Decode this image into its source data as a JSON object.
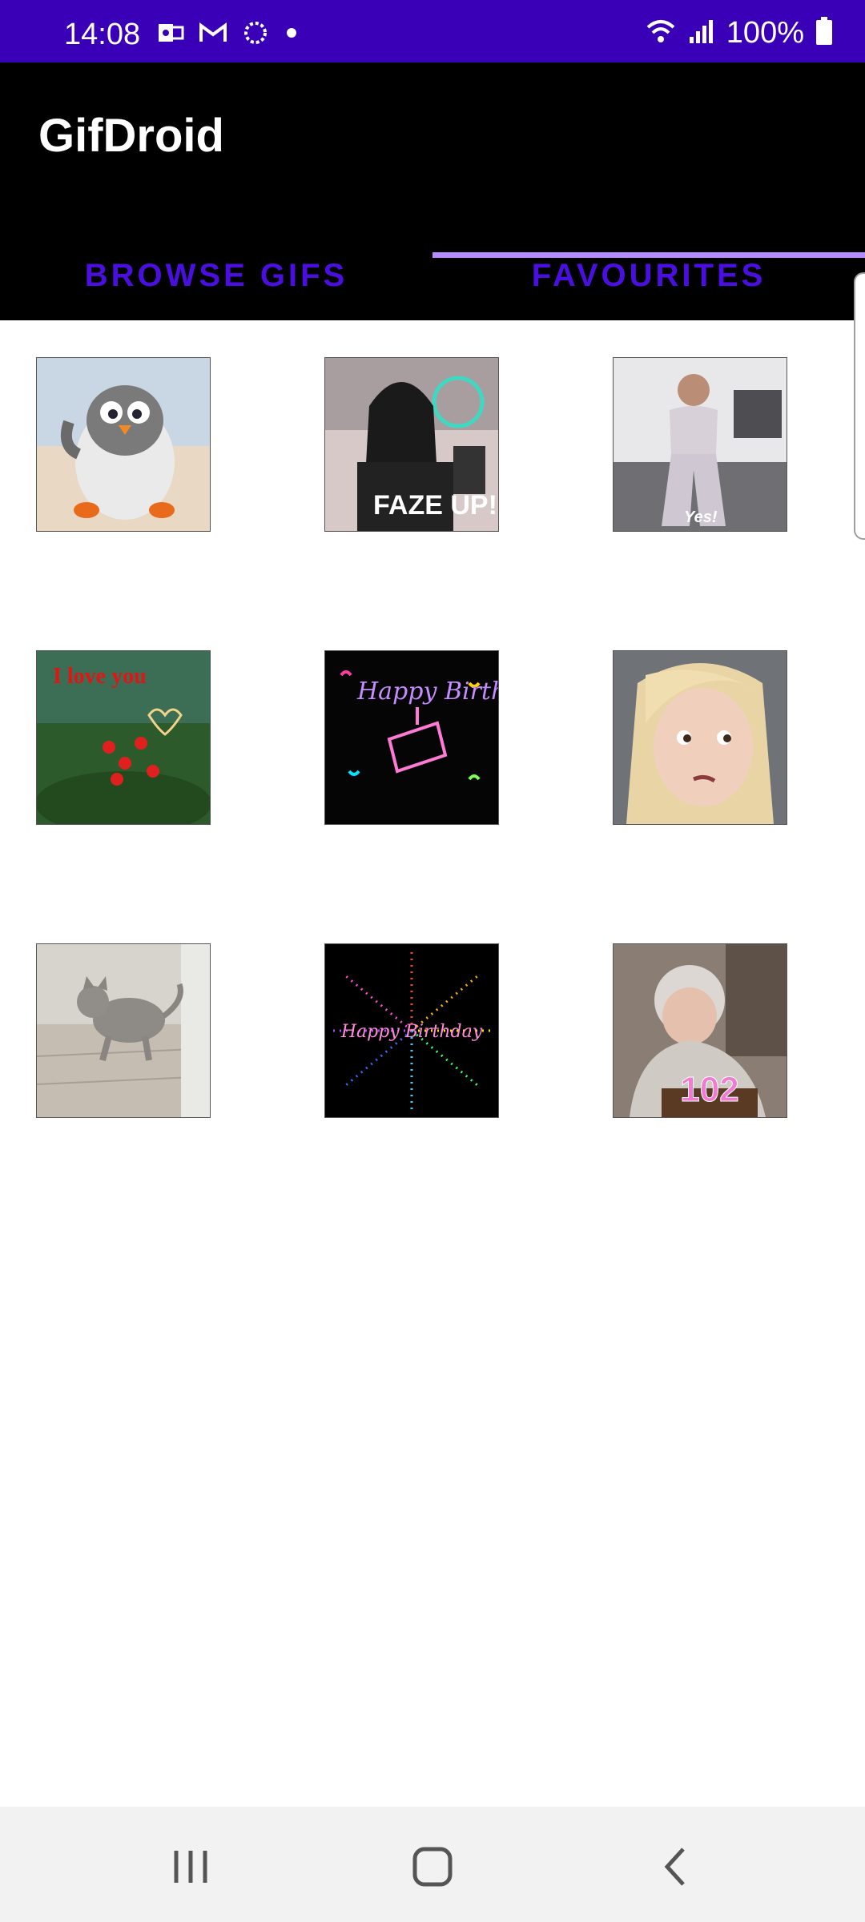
{
  "status_bar": {
    "time": "14:08",
    "battery": "100%",
    "left_icons": [
      "outlook-icon",
      "gmail-icon",
      "sync-icon",
      "dot-icon"
    ],
    "right_icons": [
      "wifi-icon",
      "signal-icon",
      "battery-icon"
    ]
  },
  "app_bar": {
    "title": "GifDroid",
    "tabs": [
      {
        "label": "BROWSE GIFS",
        "selected": false
      },
      {
        "label": "FAVOURITES",
        "selected": true
      }
    ]
  },
  "gifs": [
    {
      "name": "gif-penguin",
      "caption": ""
    },
    {
      "name": "gif-faze-up",
      "caption": "FAZE UP!"
    },
    {
      "name": "gif-yes-workout",
      "caption": "Yes!"
    },
    {
      "name": "gif-i-love-you",
      "caption": "I love you"
    },
    {
      "name": "gif-happy-birthday-neon",
      "caption": "Happy Birthday"
    },
    {
      "name": "gif-side-eye-girl",
      "caption": ""
    },
    {
      "name": "gif-kitten",
      "caption": ""
    },
    {
      "name": "gif-happy-birthday-fireworks",
      "caption": "Happy Birthday"
    },
    {
      "name": "gif-birthday-102",
      "caption": "102"
    }
  ],
  "nav_bar": {
    "icons": [
      "recents-icon",
      "home-icon",
      "back-icon"
    ]
  },
  "colors": {
    "status_bar": "#3a00b8",
    "app_bar": "#000000",
    "tab_text": "#4a0fe0",
    "indicator": "#b58bff"
  }
}
